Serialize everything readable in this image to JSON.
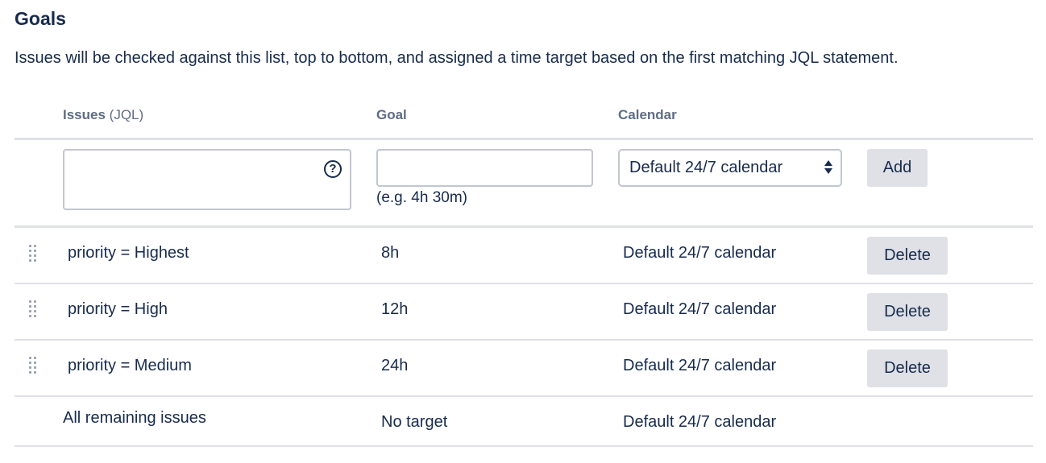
{
  "section": {
    "title": "Goals",
    "description": "Issues will be checked against this list, top to bottom, and assigned a time target based on the first matching JQL statement."
  },
  "columns": {
    "issues_main": "Issues",
    "issues_suffix": "(JQL)",
    "goal": "Goal",
    "calendar": "Calendar"
  },
  "new_row": {
    "jql_value": "",
    "goal_value": "",
    "goal_hint": "(e.g. 4h 30m)",
    "calendar_selected": "Default 24/7 calendar",
    "add_label": "Add",
    "help_icon": "question-circle-icon",
    "help_glyph": "?"
  },
  "rows": [
    {
      "jql": "priority = Highest",
      "goal": "8h",
      "calendar": "Default 24/7 calendar",
      "delete_label": "Delete"
    },
    {
      "jql": "priority = High",
      "goal": "12h",
      "calendar": "Default 24/7 calendar",
      "delete_label": "Delete"
    },
    {
      "jql": "priority = Medium",
      "goal": "24h",
      "calendar": "Default 24/7 calendar",
      "delete_label": "Delete"
    }
  ],
  "remaining": {
    "label": "All remaining issues",
    "goal": "No target",
    "calendar": "Default 24/7 calendar"
  },
  "icons": {
    "drag": "drag-handle-icon",
    "select": "select-arrows-icon"
  },
  "colors": {
    "text": "#172b4d",
    "header_text": "#5e6c84",
    "button_bg": "#dfe1e6",
    "border": "#c1c7d0",
    "divider": "#dfe1e6"
  }
}
